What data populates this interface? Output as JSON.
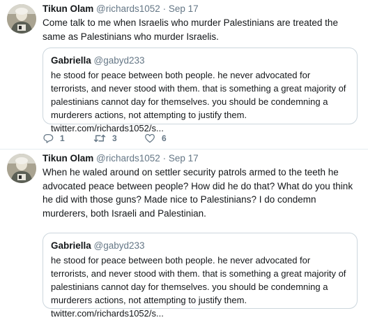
{
  "tweets": [
    {
      "author": {
        "name": "Tikun Olam",
        "handle": "@richards1052",
        "separator": "·",
        "date": "Sep 17"
      },
      "text": "Come talk to me when Israelis who murder Palestinians are treated the same as Palestinians who murder Israelis.",
      "quote": {
        "author": {
          "name": "Gabriella",
          "handle": "@gabyd233"
        },
        "text": "he stood for peace between both people. he never advocated for terrorists, and never stood with them. that is something a great majority of palestinians cannot day for themselves. you should be condemning a murderers actions, not attempting to justify them. twitter.com/richards1052/s..."
      },
      "actions": {
        "reply_count": "1",
        "retweet_count": "3",
        "like_count": "6"
      }
    },
    {
      "author": {
        "name": "Tikun Olam",
        "handle": "@richards1052",
        "separator": "·",
        "date": "Sep 17"
      },
      "text": "When he waled around on settler security patrols armed to the teeth he advocated peace between people? How did he do that?  What do you think he did with those guns? Made nice to Palestinians?  I do condemn murderers, both Israeli and Palestinian.",
      "quote": {
        "author": {
          "name": "Gabriella",
          "handle": "@gabyd233"
        },
        "text": "he stood for peace between both people. he never advocated for terrorists, and never stood with them. that is something a great majority of palestinians cannot day for themselves. you should be condemning a murderers actions, not attempting to justify them. twitter.com/richards1052/s..."
      }
    }
  ],
  "icons": {
    "reply": "reply-icon",
    "retweet": "retweet-icon",
    "like": "heart-icon",
    "avatar": "avatar-photo"
  },
  "colors": {
    "text": "#14171a",
    "secondary": "#657786",
    "border": "#ccd6dd",
    "divider": "#e6ecf0"
  }
}
